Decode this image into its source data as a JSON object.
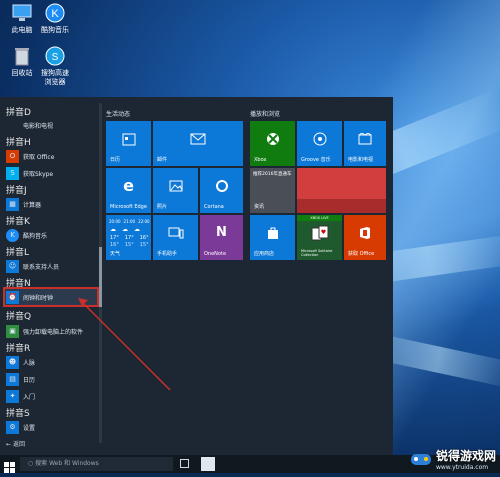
{
  "desktop": {
    "icons": [
      {
        "label": "此电脑",
        "icon": "computer-icon"
      },
      {
        "label": "酷狗音乐",
        "icon": "kugou-icon"
      },
      {
        "label": "回收站",
        "icon": "recycle-bin-icon"
      },
      {
        "label": "搜狗高速\n浏览器",
        "icon": "sogou-browser-icon"
      }
    ]
  },
  "start_menu": {
    "groups": [
      {
        "title": "拼音D",
        "apps": [
          "电影和电视"
        ]
      },
      {
        "title": "拼音H",
        "apps": [
          "获取 Office",
          "获取Skype"
        ]
      },
      {
        "title": "拼音J",
        "apps": [
          "计算器"
        ]
      },
      {
        "title": "拼音K",
        "apps": [
          "酷狗音乐"
        ]
      },
      {
        "title": "拼音L",
        "apps": [
          "联系支持人员"
        ]
      },
      {
        "title": "拼音N",
        "apps": [
          "闹钟和时钟"
        ]
      },
      {
        "title": "拼音Q",
        "apps": [
          "强力卸载电脑上的软件"
        ]
      },
      {
        "title": "拼音R",
        "apps": [
          "人脉",
          "日历",
          "入门"
        ]
      },
      {
        "title": "拼音S",
        "apps": [
          "设置"
        ]
      }
    ],
    "back_label": "返回",
    "sections": {
      "life": "生活动态",
      "play": "播放和浏览"
    },
    "tiles": {
      "calendar": "日历",
      "mail": "邮件",
      "edge": "Microsoft Edge",
      "photos": "照片",
      "cortana": "Cortana",
      "xbox": "Xbox",
      "groove": "Groove 音乐",
      "movies": "电影和电视",
      "news_text": "推荐2016年直通车",
      "news": "资讯",
      "weather_times": [
        "20:00",
        "21:00",
        "22:00"
      ],
      "weather_temps": [
        "17°",
        "17°",
        "16°"
      ],
      "weather_lows": [
        "16°",
        "15°",
        "15°"
      ],
      "weather": "天气",
      "phone": "手机助手",
      "onenote": "OneNote",
      "store": "应用商店",
      "solitaire_badge": "XBOX LIVE",
      "solitaire": "Microsoft Solitaire Collection",
      "office": "获取 Office"
    }
  },
  "taskbar": {
    "search_placeholder": "搜索 Web 和 Windows"
  },
  "watermark": {
    "title": "锐得游戏网",
    "url": "www.ytruida.com"
  },
  "colors": {
    "tile_blue": "#0c78d7",
    "xbox_green": "#107c10",
    "news_red": "#d23e3e",
    "onenote_purple": "#7b3a97",
    "office_orange": "#d83b01",
    "annotation_red": "#c9302c"
  }
}
